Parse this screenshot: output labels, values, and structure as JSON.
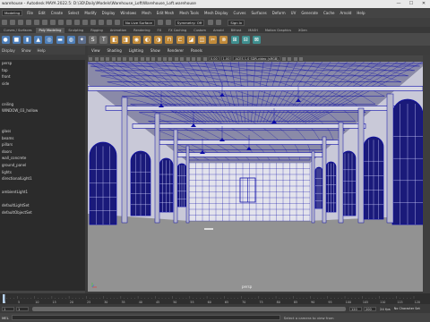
{
  "window": {
    "title": "warehouse - Autodesk MAYA 2022.5: D:\\3D\\Daily\\Models\\Warehouse_Loft\\Warehouse_Loft.warehouse",
    "minimize": "—",
    "maximize": "☐",
    "close": "✕"
  },
  "menubar": {
    "workspace": "Modeling",
    "items": [
      "File",
      "Edit",
      "Create",
      "Select",
      "Modify",
      "Display",
      "Windows",
      "Mesh",
      "Edit Mesh",
      "Mesh Tools",
      "Mesh Display",
      "Curves",
      "Surfaces",
      "Deform",
      "UV",
      "Generate",
      "Cache",
      "Arnold",
      "Help"
    ],
    "live_surface": "No Live Surface",
    "symmetry": "Symmetry: Off",
    "signin": "Sign In"
  },
  "shelf_tabs": [
    "Curves / Surfaces",
    "Poly Modeling",
    "Sculpting",
    "Rigging",
    "Animation",
    "Rendering",
    "FX",
    "FX Caching",
    "Custom",
    "Arnold",
    "Bifrost",
    "MASH",
    "Motion Graphics",
    "XGen"
  ],
  "shelf_active": 1,
  "shelf_icons": [
    {
      "name": "sphere-icon",
      "color": "#4f7fb8",
      "glyph": "●"
    },
    {
      "name": "cube-icon",
      "color": "#4f7fb8",
      "glyph": "■"
    },
    {
      "name": "cylinder-icon",
      "color": "#4f7fb8",
      "glyph": "▮"
    },
    {
      "name": "cone-icon",
      "color": "#4f7fb8",
      "glyph": "▲"
    },
    {
      "name": "torus-icon",
      "color": "#4f7fb8",
      "glyph": "◎"
    },
    {
      "name": "plane-icon",
      "color": "#4f7fb8",
      "glyph": "▬"
    },
    {
      "name": "disc-icon",
      "color": "#4f7fb8",
      "glyph": "◍"
    },
    {
      "name": "super-shape-icon",
      "color": "#5d6e8c",
      "glyph": "✦"
    },
    {
      "name": "svg-icon",
      "color": "#6d6d6d",
      "glyph": "S"
    },
    {
      "name": "type-icon",
      "color": "#6d6d6d",
      "glyph": "T"
    },
    {
      "name": "combine-icon",
      "color": "#c08a3a",
      "glyph": "◧"
    },
    {
      "name": "separate-icon",
      "color": "#c08a3a",
      "glyph": "◨"
    },
    {
      "name": "smooth-icon",
      "color": "#c08a3a",
      "glyph": "◉"
    },
    {
      "name": "boolean-icon",
      "color": "#c08a3a",
      "glyph": "◐"
    },
    {
      "name": "mirror-icon",
      "color": "#c08a3a",
      "glyph": "◑"
    },
    {
      "name": "bridge-icon",
      "color": "#c08a3a",
      "glyph": "⊓"
    },
    {
      "name": "extrude-icon",
      "color": "#c08a3a",
      "glyph": "⊏"
    },
    {
      "name": "bevel-icon",
      "color": "#c08a3a",
      "glyph": "◪"
    },
    {
      "name": "fill-hole-icon",
      "color": "#c08a3a",
      "glyph": "◫"
    },
    {
      "name": "multi-cut-icon",
      "color": "#c08a3a",
      "glyph": "✂"
    },
    {
      "name": "target-weld-icon",
      "color": "#c08a3a",
      "glyph": "⊗"
    },
    {
      "name": "uv-editor-icon",
      "color": "#3f8f8f",
      "glyph": "⊞"
    },
    {
      "name": "planar-map-icon",
      "color": "#3f8f8f",
      "glyph": "⊟"
    },
    {
      "name": "auto-map-icon",
      "color": "#3f8f8f",
      "glyph": "⊠"
    }
  ],
  "left_panel": {
    "menus": [
      "Display",
      "Show",
      "Help"
    ],
    "outliner_items": [
      "persp",
      "top",
      "front",
      "side",
      "",
      "",
      "ceiling",
      "WINDOW_03_hollow",
      "",
      "",
      "glass",
      "beams",
      "pillars",
      "doors",
      "wall_concrete",
      "ground_panel",
      "lights",
      "directionalLight1",
      "",
      "ambientLight1",
      "",
      "defaultLightSet",
      "defaultObjectSet"
    ]
  },
  "viewport": {
    "menus": [
      "View",
      "Shading",
      "Lighting",
      "Show",
      "Renderer",
      "Panels"
    ],
    "field_a": "0.00",
    "field_b": "1.00",
    "color_space": "ACES 1.0 SDR-video (sRGB)",
    "camera_label": "persp"
  },
  "timeline": {
    "ticks": [
      "1",
      "5",
      "10",
      "15",
      "20",
      "25",
      "30",
      "35",
      "40",
      "45",
      "50",
      "55",
      "60",
      "65",
      "70",
      "75",
      "80",
      "85",
      "90",
      "95",
      "100",
      "105",
      "110",
      "115",
      "120"
    ],
    "current_frame": "1"
  },
  "range": {
    "start": "1",
    "start_inner": "1",
    "end_inner": "120",
    "end": "200",
    "fps": "24 fps",
    "char_set": "No Character Set",
    "anim_layer": "No Anim Layer"
  },
  "command_line": {
    "lang": "MEL",
    "status": "Select a camera to view from"
  },
  "colors": {
    "wire": "#0c0ca8",
    "viewport_bg": "#6b6b6b",
    "floor": "#929292",
    "backwall": "#e3e3ec"
  }
}
